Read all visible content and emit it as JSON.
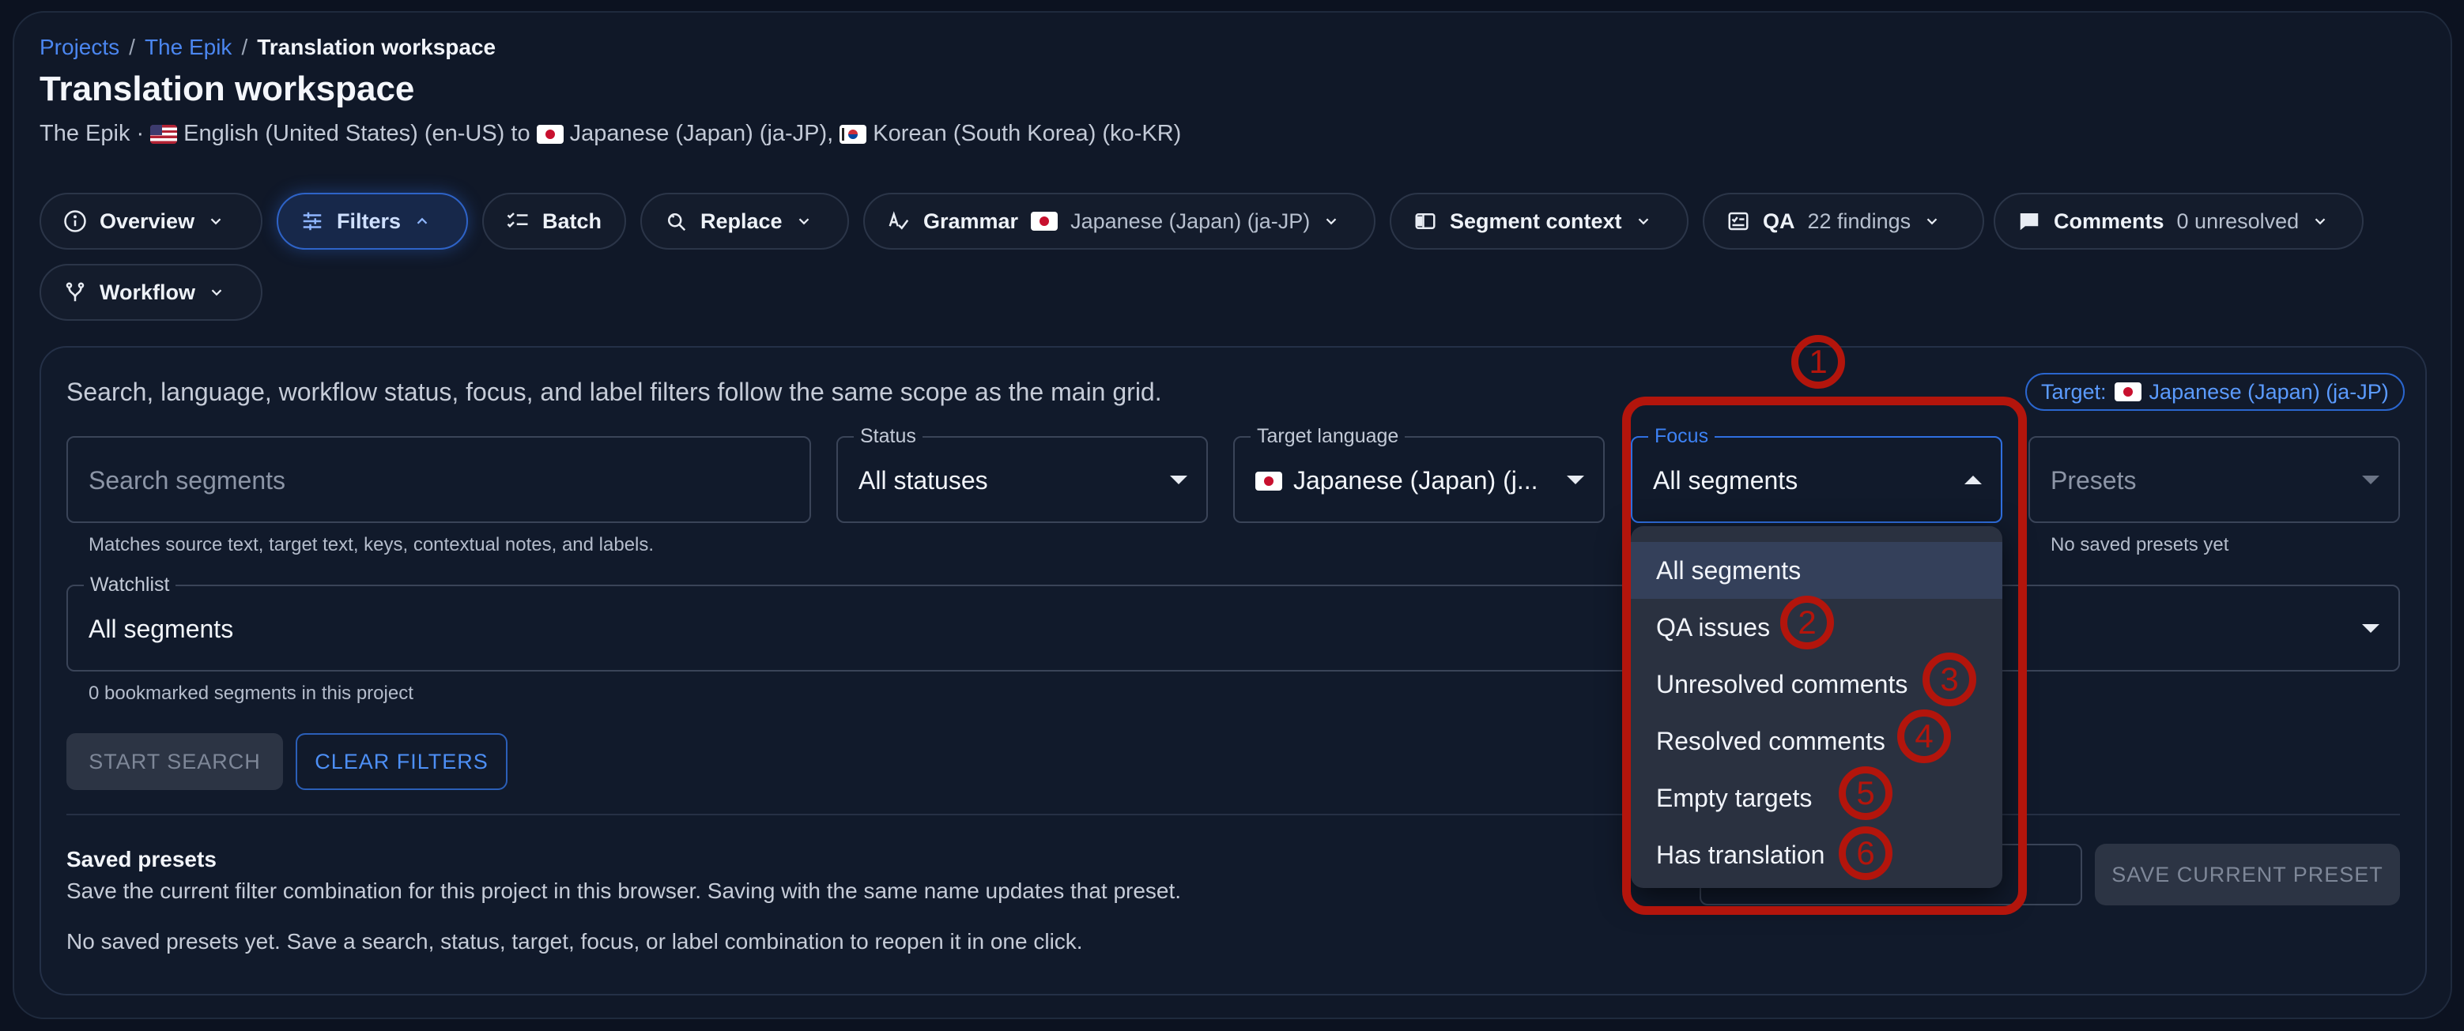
{
  "breadcrumb": {
    "projects": "Projects",
    "project": "The Epik",
    "current": "Translation workspace",
    "separator": "/"
  },
  "page": {
    "title": "Translation workspace",
    "subtitle_project": "The Epik ·",
    "source_lang": "English (United States) (en-US) to",
    "target_lang_1": "Japanese (Japan) (ja-JP),",
    "target_lang_2": "Korean (South Korea) (ko-KR)"
  },
  "toolbar": {
    "overview": "Overview",
    "filters": "Filters",
    "batch": "Batch",
    "replace": "Replace",
    "grammar": "Grammar",
    "grammar_lang": "Japanese (Japan) (ja-JP)",
    "segment_context": "Segment context",
    "qa": "QA",
    "qa_count": "22 findings",
    "comments": "Comments",
    "comments_count": "0 unresolved",
    "workflow": "Workflow"
  },
  "filters": {
    "intro": "Search, language, workflow status, focus, and label filters follow the same scope as the main grid.",
    "target_chip_label": "Target:",
    "target_chip_value": "Japanese (Japan) (ja-JP)",
    "search_placeholder": "Search segments",
    "search_helper": "Matches source text, target text, keys, contextual notes, and labels.",
    "status_label": "Status",
    "status_value": "All statuses",
    "target_label": "Target language",
    "target_value": "Japanese (Japan) (j...",
    "focus_label": "Focus",
    "focus_value": "All segments",
    "presets_placeholder": "Presets",
    "presets_helper": "No saved presets yet",
    "watchlist_label": "Watchlist",
    "watchlist_value": "All segments",
    "watchlist_helper": "0 bookmarked segments in this project",
    "start_search": "START SEARCH",
    "clear_filters": "CLEAR FILTERS"
  },
  "saved_presets": {
    "title": "Saved presets",
    "description": "Save the current filter combination for this project in this browser. Saving with the same name updates that preset.",
    "empty": "No saved presets yet. Save a search, status, target, focus, or label combination to reopen it in one click.",
    "save_button": "SAVE CURRENT PRESET"
  },
  "focus_menu": {
    "options": [
      "All segments",
      "QA issues",
      "Unresolved comments",
      "Resolved comments",
      "Empty targets",
      "Has translation"
    ],
    "selected": "All segments"
  },
  "annotations": [
    "1",
    "2",
    "3",
    "4",
    "5",
    "6"
  ],
  "colors": {
    "accent": "#3d82f5",
    "annotation": "#b3150c",
    "background": "#0c1220",
    "menu": "#2a3140"
  },
  "icons": [
    "info-icon",
    "sliders-icon",
    "checklist-icon",
    "search-replace-icon",
    "spellcheck-icon",
    "context-panel-icon",
    "qa-report-icon",
    "comment-icon",
    "fork-icon",
    "chevron-down-icon",
    "chevron-up-icon"
  ]
}
